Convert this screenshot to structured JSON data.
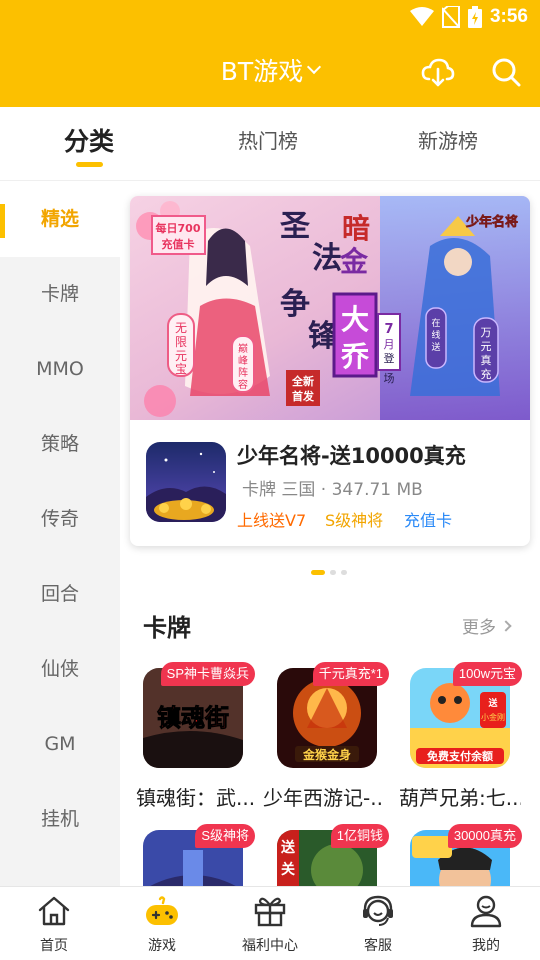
{
  "status_bar": {
    "time": "3:56",
    "icons": [
      "wifi-icon",
      "no-sim-icon",
      "battery-charging-icon"
    ]
  },
  "header": {
    "title": "BT游戏",
    "icons": [
      "chevron-down-icon",
      "cloud-download-icon",
      "search-icon"
    ],
    "background": "#fcc000"
  },
  "tabs": [
    {
      "label": "分类",
      "active": true
    },
    {
      "label": "热门榜",
      "active": false
    },
    {
      "label": "新游榜",
      "active": false
    }
  ],
  "sidebar": {
    "items": [
      {
        "label": "精选",
        "active": true
      },
      {
        "label": "卡牌"
      },
      {
        "label": "MMO"
      },
      {
        "label": "策略"
      },
      {
        "label": "传奇"
      },
      {
        "label": "回合"
      },
      {
        "label": "仙侠"
      },
      {
        "label": "GM"
      },
      {
        "label": "挂机"
      }
    ]
  },
  "featured": {
    "banner": {
      "corner_badge": "每日700充值卡",
      "title_left": "圣法争锋",
      "title_right": "暗金大乔",
      "left_tag": "无限元宝",
      "left_tag2": "巅峰阵容",
      "new_release": "全新首发",
      "launch": "7月登场",
      "right_tag": "在线送",
      "right_tag2": "万元真充",
      "logo": "少年名将"
    },
    "game": {
      "title": "少年名将-送10000真充",
      "meta": "卡牌 三国 · 347.71 MB",
      "tags": [
        {
          "label": "上线送V7",
          "color": "#ff6a00"
        },
        {
          "label": "S级神将",
          "color": "#f2a500"
        },
        {
          "label": "充值卡",
          "color": "#2b8af7"
        }
      ]
    },
    "carousel": {
      "count": 3,
      "active_index": 0
    }
  },
  "section": {
    "title": "卡牌",
    "more_label": "更多",
    "games": [
      {
        "badge": "SP神卡曹焱兵",
        "name": "镇魂街：武...",
        "art_text": "镇魂街"
      },
      {
        "badge": "千元真充*1",
        "name": "少年西游记-...",
        "art_text": "金猴金身"
      },
      {
        "badge": "100w元宝",
        "name": "葫芦兄弟:七...",
        "art_text": "送小金刚 免费支付余额"
      },
      {
        "badge": "S级神将",
        "name": ""
      },
      {
        "badge": "1亿铜钱",
        "name": "",
        "art_text": "送关"
      },
      {
        "badge": "30000真充",
        "name": ""
      }
    ]
  },
  "bottom_nav": [
    {
      "label": "首页",
      "icon": "home-icon"
    },
    {
      "label": "游戏",
      "icon": "gamepad-icon",
      "active": true
    },
    {
      "label": "福利中心",
      "icon": "gift-icon"
    },
    {
      "label": "客服",
      "icon": "headset-icon"
    },
    {
      "label": "我的",
      "icon": "user-icon"
    }
  ]
}
